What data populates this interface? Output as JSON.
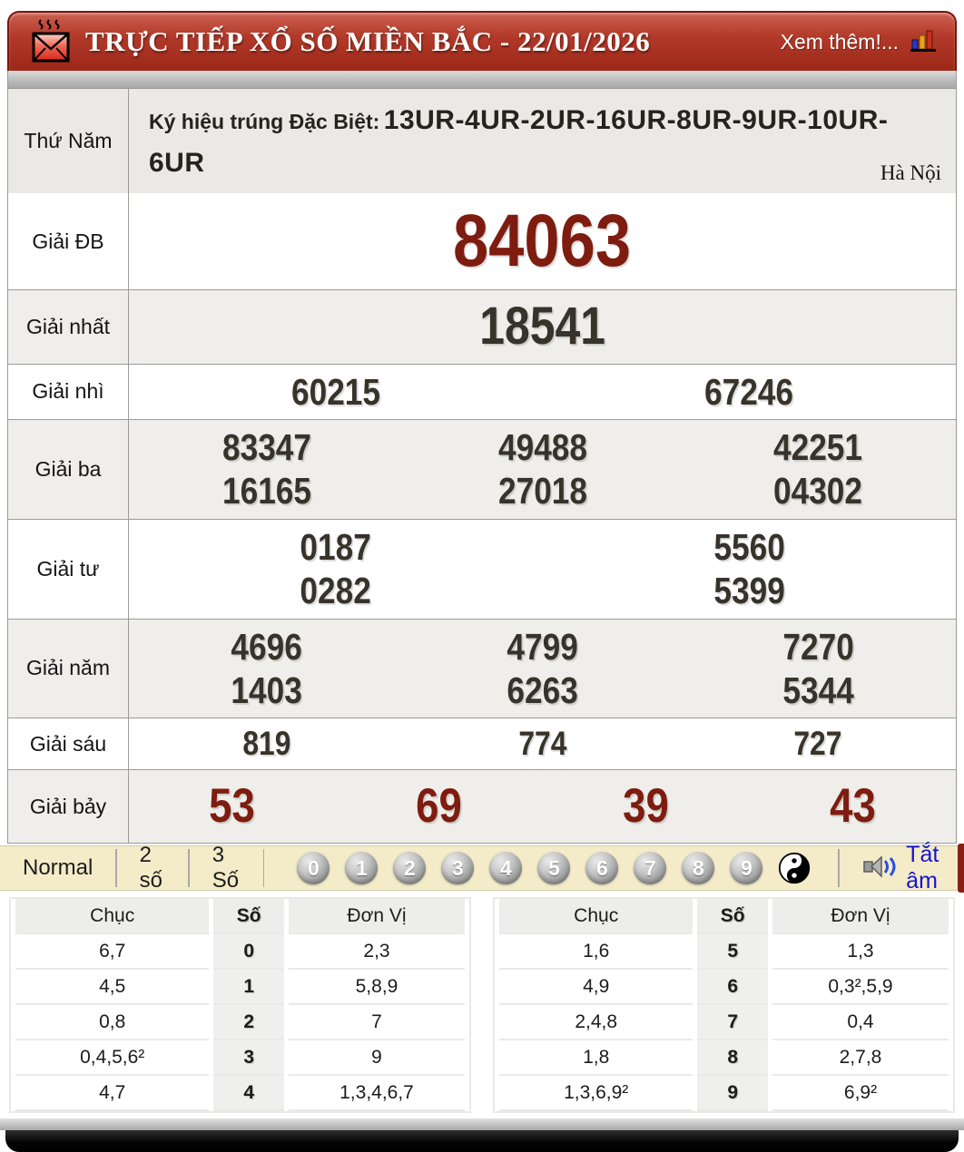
{
  "header": {
    "title": "TRỰC TIẾP XỔ SỐ MIỀN BẮC - 22/01/2026",
    "more": "Xem thêm!...",
    "envelope_icon": "hot-mail-icon",
    "chart_icon": "bar-chart-icon"
  },
  "draw": {
    "day": "Thứ Năm",
    "sign_label": "Ký hiệu trúng Đặc Biệt:",
    "sign_value": "13UR-4UR-2UR-16UR-8UR-9UR-10UR-6UR",
    "province": "Hà Nội"
  },
  "prizes": [
    {
      "label": "Giải ĐB",
      "emphasis": "db",
      "lines": [
        [
          "84063"
        ]
      ]
    },
    {
      "label": "Giải nhất",
      "emphasis": "first",
      "lines": [
        [
          "18541"
        ]
      ]
    },
    {
      "label": "Giải nhì",
      "emphasis": "normal",
      "lines": [
        [
          "60215",
          "67246"
        ]
      ]
    },
    {
      "label": "Giải ba",
      "emphasis": "normal",
      "lines": [
        [
          "83347",
          "49488",
          "42251"
        ],
        [
          "16165",
          "27018",
          "04302"
        ]
      ]
    },
    {
      "label": "Giải tư",
      "emphasis": "normal",
      "lines": [
        [
          "0187",
          "5560"
        ],
        [
          "0282",
          "5399"
        ]
      ]
    },
    {
      "label": "Giải năm",
      "emphasis": "normal",
      "lines": [
        [
          "4696",
          "4799",
          "7270"
        ],
        [
          "1403",
          "6263",
          "5344"
        ]
      ]
    },
    {
      "label": "Giải sáu",
      "emphasis": "six",
      "lines": [
        [
          "819",
          "774",
          "727"
        ]
      ]
    },
    {
      "label": "Giải bảy",
      "emphasis": "seven",
      "lines": [
        [
          "53",
          "69",
          "39",
          "43"
        ]
      ]
    }
  ],
  "controls": {
    "modes": [
      "Normal",
      "2 số",
      "3 Số"
    ],
    "balls": [
      "0",
      "1",
      "2",
      "3",
      "4",
      "5",
      "6",
      "7",
      "8",
      "9"
    ],
    "yinyang_icon": "yin-yang-icon",
    "mute": {
      "speaker_icon": "speaker-icon",
      "label": "Tắt âm"
    }
  },
  "stats": {
    "headers": [
      "Chục",
      "Số",
      "Đơn Vị"
    ],
    "left_rows": [
      [
        "6,7",
        "0",
        "2,3"
      ],
      [
        "4,5",
        "1",
        "5,8,9"
      ],
      [
        "0,8",
        "2",
        "7"
      ],
      [
        "0,4,5,6²",
        "3",
        "9"
      ],
      [
        "4,7",
        "4",
        "1,3,4,6,7"
      ]
    ],
    "right_rows": [
      [
        "1,6",
        "5",
        "1,3"
      ],
      [
        "4,9",
        "6",
        "0,3²,5,9"
      ],
      [
        "2,4,8",
        "7",
        "0,4"
      ],
      [
        "1,8",
        "8",
        "2,7,8"
      ],
      [
        "1,3,6,9²",
        "9",
        "6,9²"
      ]
    ]
  },
  "colors": {
    "accent_red": "#7e1c10",
    "header_red": "#a93122",
    "control_beige": "#f4ebc9",
    "link_blue": "#1515cd",
    "shade_gray": "#efeeeb"
  }
}
